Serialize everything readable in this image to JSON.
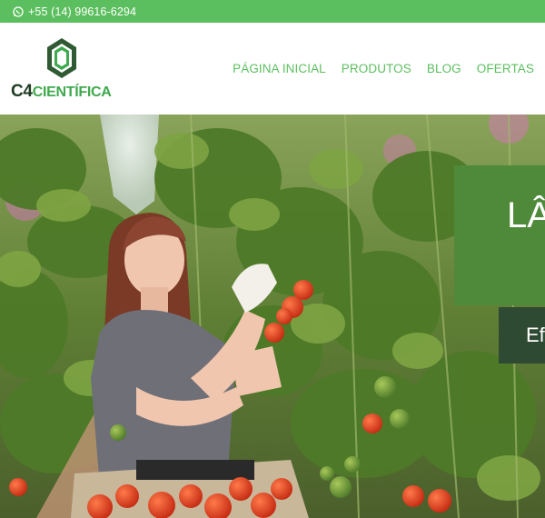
{
  "topbar": {
    "phone": "+55 (14) 99616-6294",
    "icon": "whatsapp-icon"
  },
  "logo": {
    "prefix": "C4",
    "suffix": "CIENTÍFICA"
  },
  "nav": {
    "items": [
      "PÁGINA INICIAL",
      "PRODUTOS",
      "BLOG",
      "OFERTAS"
    ]
  },
  "hero": {
    "banner_title": "LÂ",
    "banner_subtitle": "Ef"
  },
  "colors": {
    "accent": "#5cbf5f",
    "logo_dark": "#1f3b23",
    "banner": "#4f8a3a",
    "subbanner": "#2e4a33"
  }
}
